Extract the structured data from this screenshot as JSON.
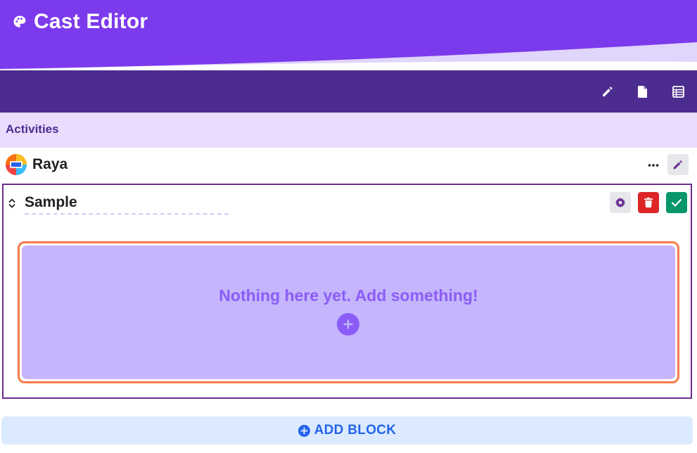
{
  "header": {
    "title": "Cast Editor",
    "icon": "palette-icon"
  },
  "toolbar": {
    "icons": [
      "pencil-icon",
      "file-icon",
      "table-icon"
    ]
  },
  "section": {
    "title": "Activities"
  },
  "cast": {
    "name": "Raya",
    "avatar_icon": "raya-avatar"
  },
  "activity": {
    "name": "Sample",
    "empty_message": "Nothing here yet. Add something!"
  },
  "footer": {
    "add_block_label": "ADD BLOCK"
  },
  "colors": {
    "header": "#7c3aed",
    "toolbar": "#4c2d8f",
    "section_bar": "#ebdcfe",
    "dropzone_fill": "#c4b5fd",
    "dropzone_border": "#f47b4b",
    "delete": "#dc2626",
    "confirm": "#059669",
    "add_block_bg": "#dbeafe",
    "add_block_text": "#2563eb"
  }
}
